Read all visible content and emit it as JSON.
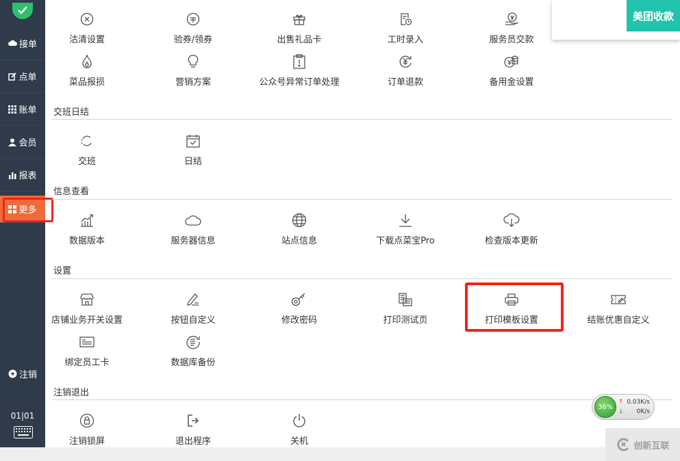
{
  "sidebar": {
    "items": [
      {
        "label": "接单",
        "icon": "cloud-icon"
      },
      {
        "label": "点单",
        "icon": "edit-icon"
      },
      {
        "label": "账单",
        "icon": "grid-icon"
      },
      {
        "label": "会员",
        "icon": "user-icon"
      },
      {
        "label": "报表",
        "icon": "bar-chart-icon"
      },
      {
        "label": "更多",
        "icon": "tiles-icon",
        "active": true
      }
    ],
    "logout": {
      "label": "注销",
      "icon": "circle-arrow-icon"
    },
    "date": "01|01",
    "active_color": "#f06b3a"
  },
  "top_right": {
    "label": "美团收款",
    "color": "#20c4ad"
  },
  "sections": {
    "misc": {
      "tiles": [
        {
          "label": "沽清设置",
          "icon": "circle-x-icon"
        },
        {
          "label": "验券/领券",
          "icon": "coupon-icon"
        },
        {
          "label": "出售礼品卡",
          "icon": "gift-icon"
        },
        {
          "label": "工时录入",
          "icon": "timesheet-icon"
        },
        {
          "label": "服务员交款",
          "icon": "money-hand-icon"
        },
        {
          "label": "菜品报损",
          "icon": "flame-icon"
        },
        {
          "label": "营销方案",
          "icon": "lightbulb-icon"
        },
        {
          "label": "公众号异常订单处理",
          "icon": "clipboard-alert-icon"
        },
        {
          "label": "订单退款",
          "icon": "yen-refund-icon"
        },
        {
          "label": "备用金设置",
          "icon": "coins-icon"
        }
      ]
    },
    "shift": {
      "title": "交班日结",
      "tiles": [
        {
          "label": "交班",
          "icon": "refresh-icon"
        },
        {
          "label": "日结",
          "icon": "calendar-check-icon"
        }
      ]
    },
    "info": {
      "title": "信息查看",
      "tiles": [
        {
          "label": "数据版本",
          "icon": "trend-chart-icon"
        },
        {
          "label": "服务器信息",
          "icon": "cloud-outline-icon"
        },
        {
          "label": "站点信息",
          "icon": "globe-icon"
        },
        {
          "label": "下载点菜宝Pro",
          "icon": "download-icon"
        },
        {
          "label": "检查版本更新",
          "icon": "cloud-download-icon"
        }
      ]
    },
    "settings": {
      "title": "设置",
      "tiles": [
        {
          "label": "店铺业务开关设置",
          "icon": "store-icon"
        },
        {
          "label": "按钮自定义",
          "icon": "pencil-icon"
        },
        {
          "label": "修改密码",
          "icon": "key-icon"
        },
        {
          "label": "打印测试页",
          "icon": "document-print-icon"
        },
        {
          "label": "打印模板设置",
          "icon": "printer-icon"
        },
        {
          "label": "结账优惠自定义",
          "icon": "ticket-edit-icon"
        },
        {
          "label": "绑定员工卡",
          "icon": "id-card-icon"
        },
        {
          "label": "数据库备份",
          "icon": "database-backup-icon"
        }
      ]
    },
    "logout": {
      "title": "注销退出",
      "tiles": [
        {
          "label": "注销锁屏",
          "icon": "lock-circle-icon"
        },
        {
          "label": "退出程序",
          "icon": "exit-icon"
        },
        {
          "label": "关机",
          "icon": "power-icon"
        }
      ]
    }
  },
  "network_widget": {
    "percent": "36%",
    "up": "0.03K/s",
    "down": "0K/s"
  },
  "watermark": {
    "text": "创新互联"
  }
}
